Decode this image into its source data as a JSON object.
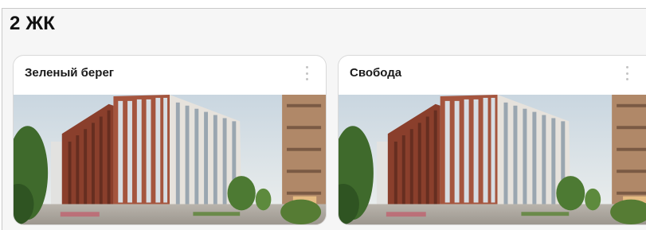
{
  "section": {
    "title": "2 ЖК"
  },
  "cards": [
    {
      "title": "Зеленый берег",
      "menu_icon": "more-vertical-icon",
      "image": "building-photo"
    },
    {
      "title": "Свобода",
      "menu_icon": "more-vertical-icon",
      "image": "building-photo"
    }
  ],
  "colors": {
    "sky": "#dce4ea",
    "brick": "#8a3f2c",
    "facade_light": "#e6e2dc",
    "greenery": "#3f6a2c"
  }
}
